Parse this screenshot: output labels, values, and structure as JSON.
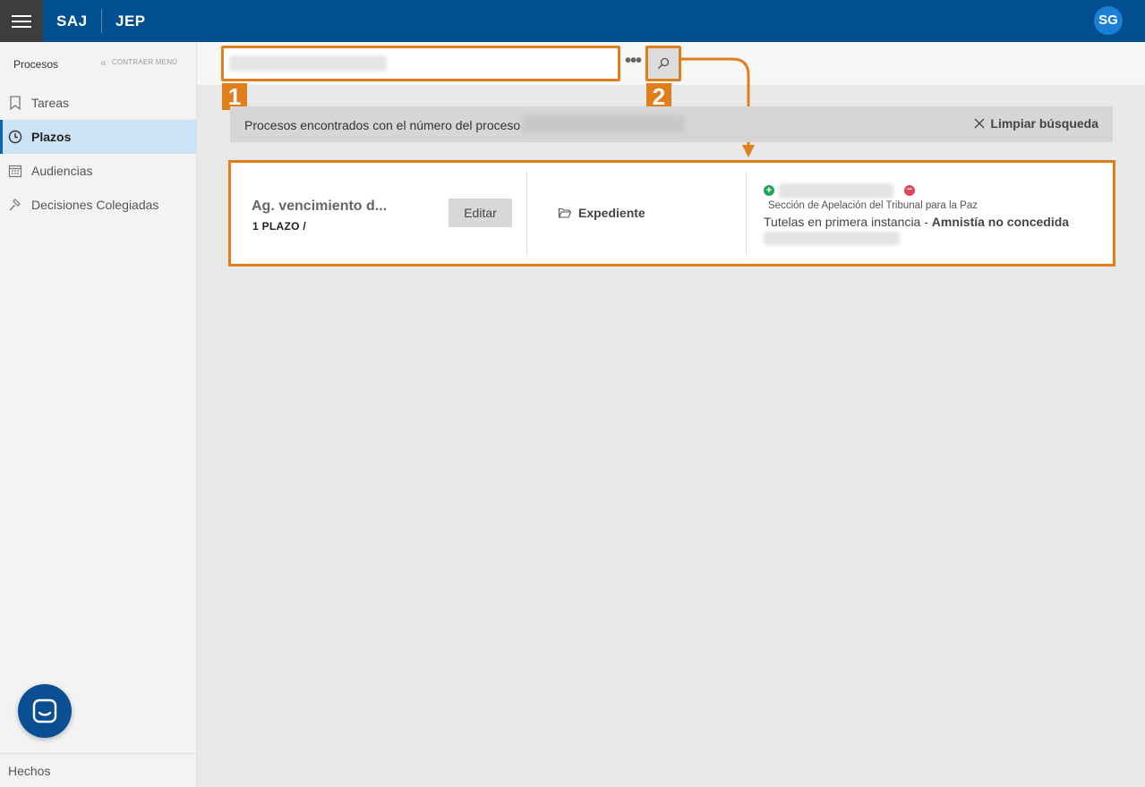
{
  "header": {
    "brand_primary": "SAJ",
    "brand_secondary": "JEP",
    "user_initials": "SG",
    "bar_color": "#024f8f"
  },
  "sidebar": {
    "title": "Procesos",
    "collapse_label": "CONTRAER MENÚ",
    "items": [
      {
        "label": "Tareas",
        "icon": "bookmark-icon",
        "active": false
      },
      {
        "label": "Plazos",
        "icon": "clock-icon",
        "active": true
      },
      {
        "label": "Audiencias",
        "icon": "calendar-icon",
        "active": false
      },
      {
        "label": "Decisiones Colegiadas",
        "icon": "gavel-icon",
        "active": false
      }
    ],
    "footer_label": "Hechos"
  },
  "search": {
    "value": "",
    "more_options_label": "•••",
    "step_badges": [
      "1",
      "2"
    ]
  },
  "results": {
    "banner_text": "Procesos encontrados con el número del proceso",
    "clear_label": "Limpiar búsqueda",
    "card": {
      "title": "Ag. vencimiento d...",
      "subtitle": "1 PLAZO /",
      "edit_label": "Editar",
      "expediente_label": "Expediente",
      "sala": "Sección de Apelación del Tribunal para la Paz",
      "tipo": "Tutelas en primera instancia",
      "separator": " - ",
      "estado": "Amnistía no concedida"
    }
  },
  "colors": {
    "accent_orange": "#e07e1b",
    "active_item_bg": "#cce3f6",
    "plus_green": "#21a45c",
    "minus_red": "#e2445c"
  }
}
